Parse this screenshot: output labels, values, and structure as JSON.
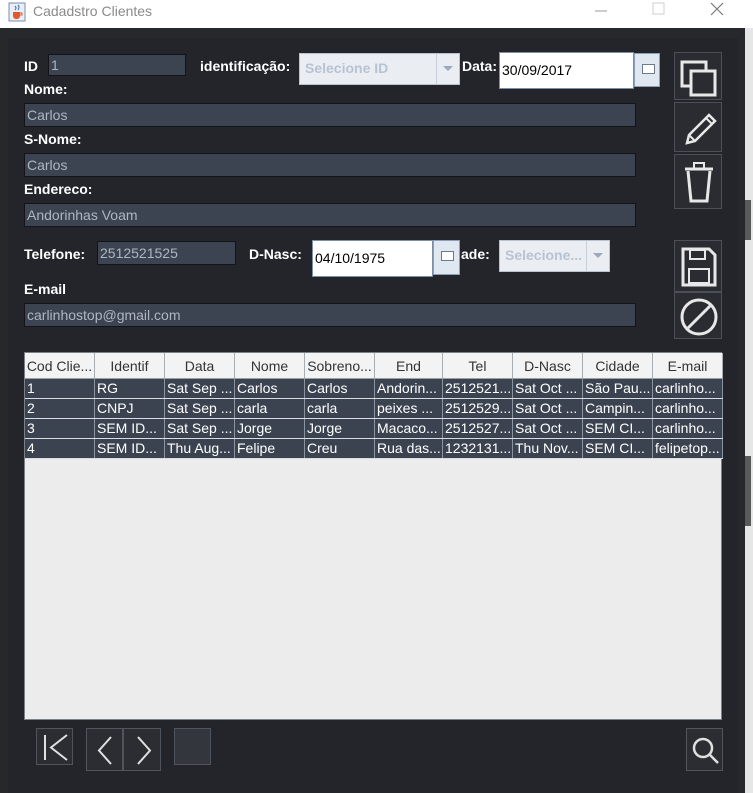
{
  "window": {
    "title": "Cadadstro Clientes",
    "app_icon": "java-cup-icon"
  },
  "form": {
    "id_label": "ID",
    "id_value": "1",
    "ident_label": "identificação:",
    "ident_select": "Selecione ID",
    "data_label": "Data:",
    "data_value": "30/09/2017",
    "nome_label": "Nome:",
    "nome_value": "Carlos",
    "snome_label": "S-Nome:",
    "snome_value": "Carlos",
    "endereco_label": "Endereco:",
    "endereco_value": "Andorinhas Voam",
    "telefone_label": "Telefone:",
    "telefone_value": "2512521525",
    "dnasc_label": "D-Nasc:",
    "dnasc_value": "04/10/1975",
    "cidade_label": "ade:",
    "cidade_select": "Selecione...",
    "email_label": "E-mail",
    "email_value": "carlinhostop@gmail.com"
  },
  "side_buttons": [
    "copy-icon",
    "edit-pencil-icon",
    "trash-icon",
    "save-floppy-icon",
    "cancel-icon"
  ],
  "table": {
    "columns": [
      "Cod Clie...",
      "Identif",
      "Data",
      "Nome",
      "Sobreno...",
      "End",
      "Tel",
      "D-Nasc",
      "Cidade",
      "E-mail"
    ],
    "rows": [
      [
        "1",
        "RG",
        "Sat Sep ...",
        "Carlos",
        "Carlos",
        "Andorin...",
        "2512521...",
        "Sat Oct ...",
        "São Pau...",
        "carlinho..."
      ],
      [
        "2",
        "CNPJ",
        "Sat Sep ...",
        "carla",
        "carla",
        "peixes ...",
        "2512529...",
        "Sat Oct ...",
        "Campin...",
        "carlinho..."
      ],
      [
        "3",
        "SEM ID...",
        "Sat Sep ...",
        "Jorge",
        "Jorge",
        "Macaco...",
        "2512527...",
        "Sat Oct ...",
        "SEM CI...",
        "carlinho..."
      ],
      [
        "4",
        "SEM ID...",
        "Thu Aug...",
        "Felipe",
        "Creu",
        "Rua das...",
        "1232131...",
        "Thu Nov...",
        "SEM CI...",
        "felipetop..."
      ]
    ]
  },
  "nav_buttons": [
    "first-icon",
    "previous-icon",
    "next-icon",
    "blank-button",
    "search-icon"
  ],
  "colors": {
    "background": "#23252b",
    "field": "#3c4451",
    "text": "#ffffff",
    "muted_text": "#aeb6c1"
  }
}
